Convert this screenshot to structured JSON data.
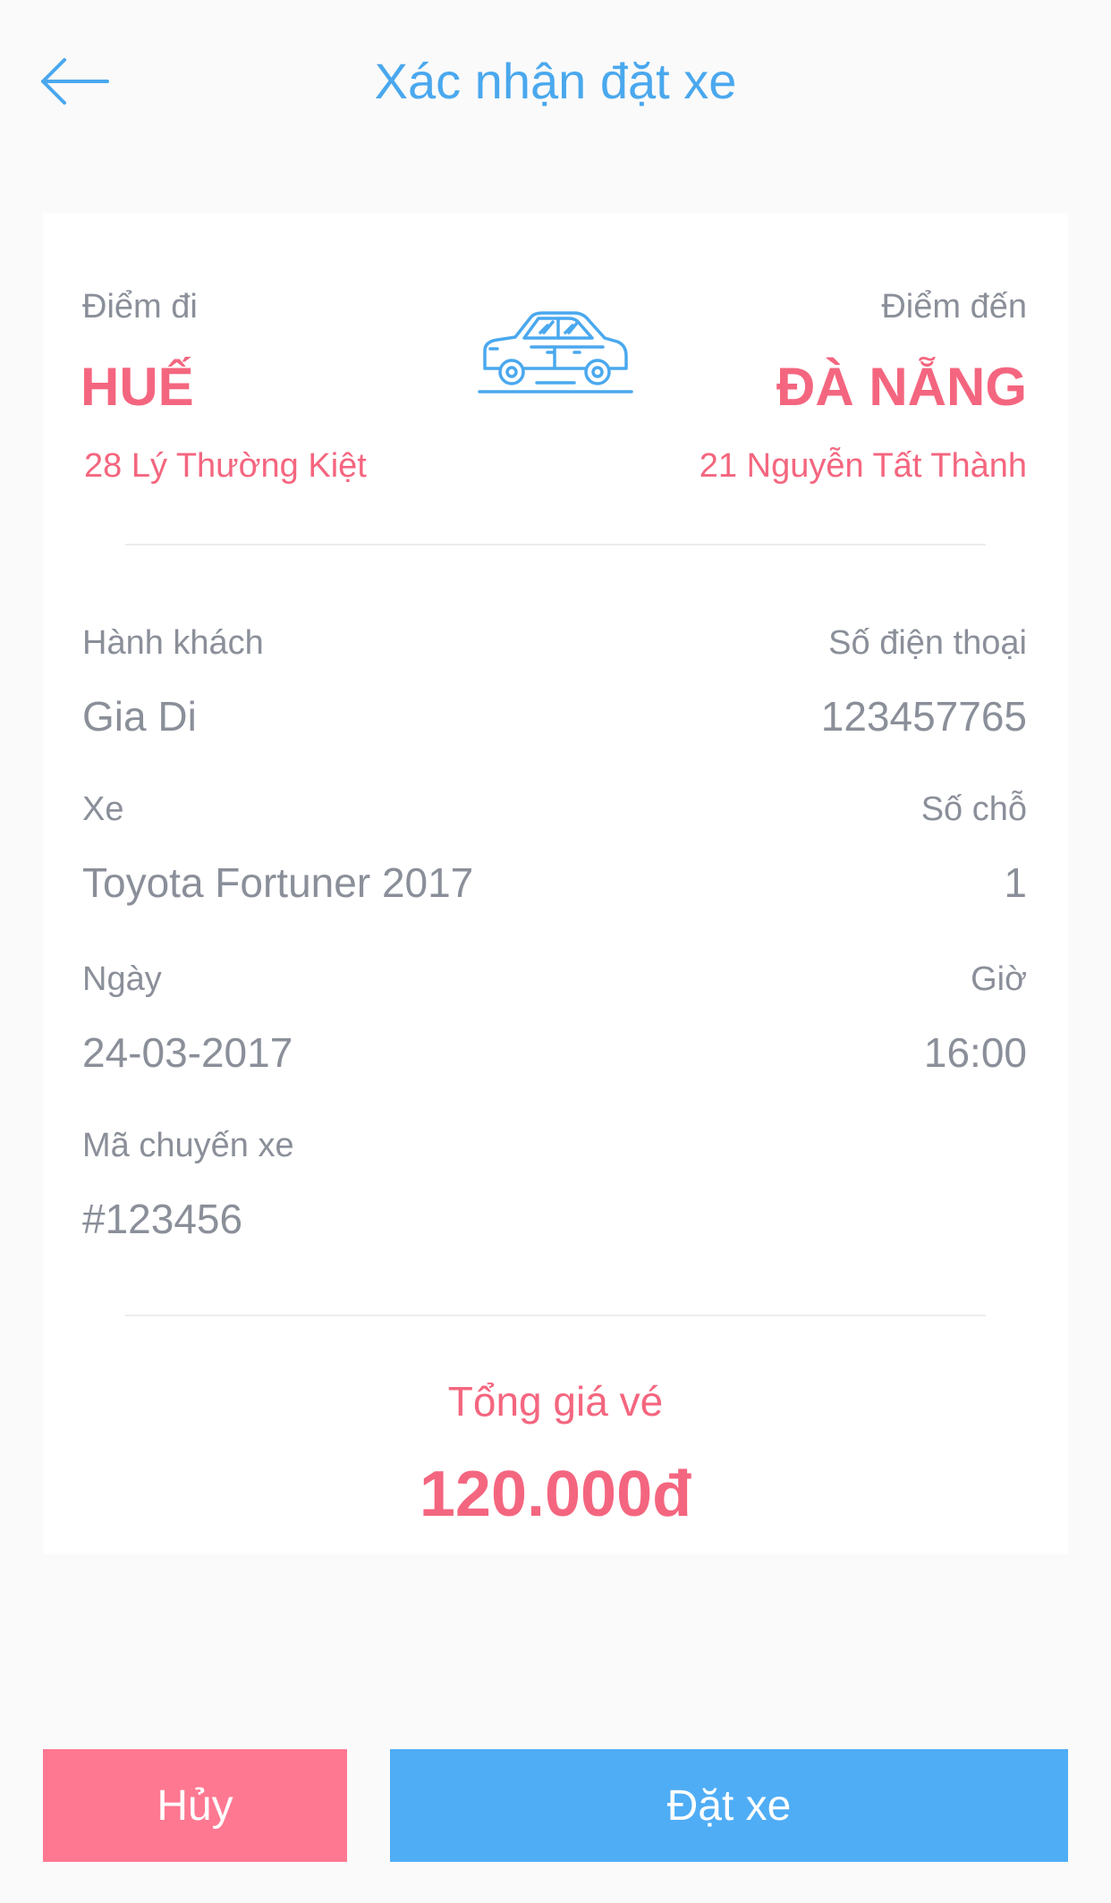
{
  "header": {
    "title": "Xác nhận đặt xe",
    "back_icon": "arrow-left-icon"
  },
  "route": {
    "from_label": "Điểm đi",
    "from_city": "HUẾ",
    "from_address": "28 Lý Thường Kiệt",
    "to_label": "Điểm đến",
    "to_city": "ĐÀ NẴNG",
    "to_address": "21 Nguyễn Tất Thành",
    "icon": "car-icon"
  },
  "details": {
    "passenger_label": "Hành khách",
    "passenger_value": "Gia Di",
    "phone_label": "Số điện thoại",
    "phone_value": "123457765",
    "car_label": "Xe",
    "car_value": "Toyota Fortuner 2017",
    "seats_label": "Số chỗ",
    "seats_value": "1",
    "date_label": "Ngày",
    "date_value": "24-03-2017",
    "time_label": "Giờ",
    "time_value": "16:00",
    "trip_code_label": "Mã chuyến xe",
    "trip_code_value": "#123456"
  },
  "total": {
    "label": "Tổng giá vé",
    "value": "120.000đ"
  },
  "actions": {
    "cancel_label": "Hủy",
    "book_label": "Đặt xe"
  },
  "colors": {
    "accent_blue": "#4aa8ee",
    "accent_pink": "#f4667f",
    "cancel_bg": "#ff7891",
    "book_bg": "#4fadf5"
  }
}
